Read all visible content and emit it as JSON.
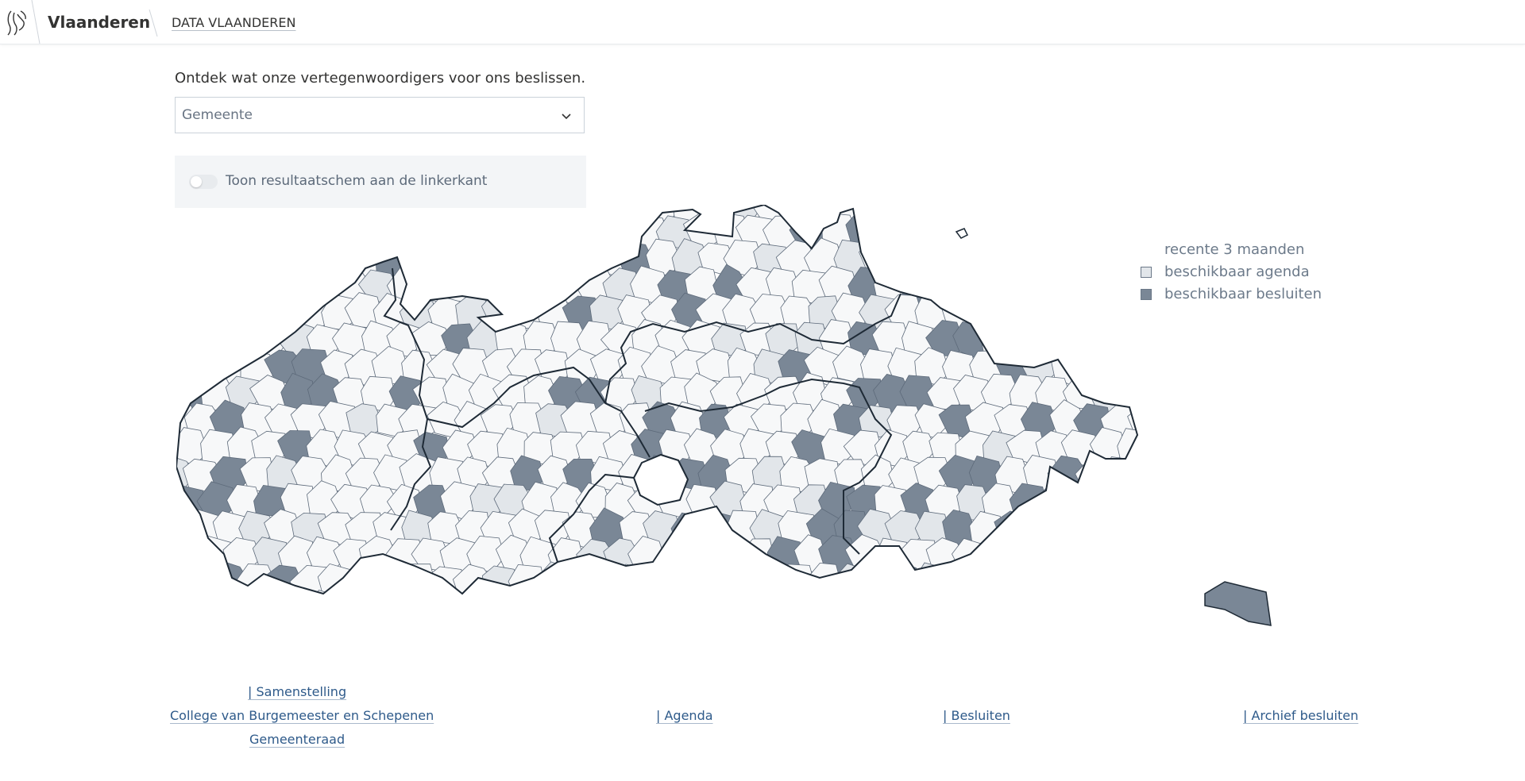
{
  "header": {
    "brand": "Vlaanderen",
    "site_title": "DATA VLAANDEREN",
    "logo_icon": "flemish-lion-icon"
  },
  "intro": "Ontdek wat onze vertegenwoordigers voor ons beslissen.",
  "municipality_select": {
    "value": "Gemeente",
    "icon": "chevron-down-icon"
  },
  "toggle": {
    "label": "Toon resultaatschem aan de linkerkant",
    "checked": false
  },
  "legend": {
    "title": "recente 3 maanden",
    "items": [
      {
        "label": "beschikbaar agenda",
        "color": "#e2e6ea"
      },
      {
        "label": "beschikbaar besluiten",
        "color": "#7a8796"
      }
    ]
  },
  "map": {
    "colors": {
      "none": "#f7f8f9",
      "agenda": "#e2e6ea",
      "besluiten": "#7a8796",
      "border": "#5d6a7a",
      "province_border": "#1e2a36"
    }
  },
  "footer": {
    "samenstelling": "| Samenstelling",
    "college": "College van Burgemeester en Schepenen",
    "gemeenteraad": "Gemeenteraad",
    "agenda": "| Agenda",
    "besluiten": "| Besluiten",
    "archief": "| Archief besluiten"
  }
}
